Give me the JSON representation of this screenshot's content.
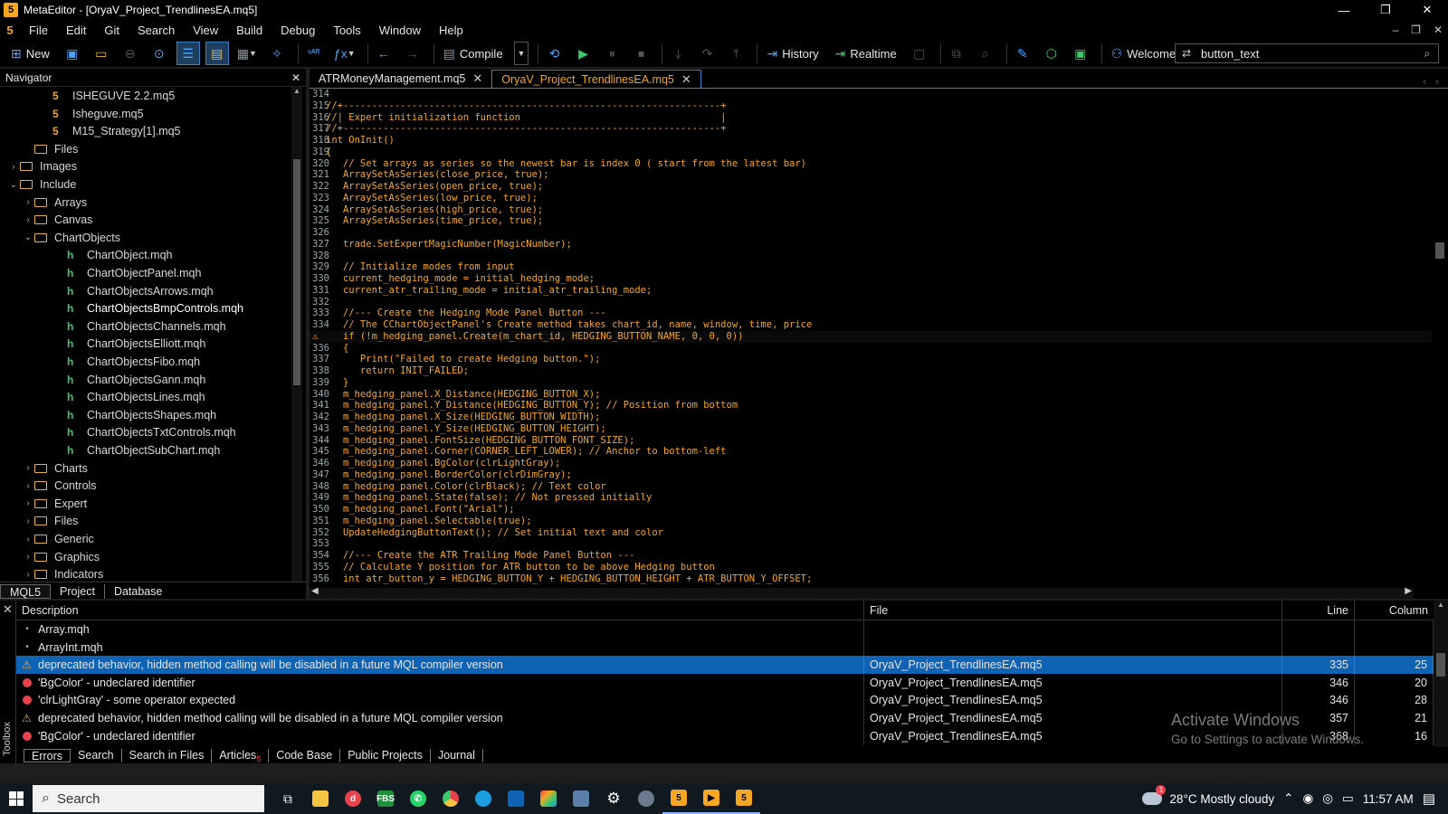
{
  "window": {
    "title": "MetaEditor - [OryaV_Project_TrendlinesEA.mq5]",
    "controls": [
      "—",
      "❐",
      "✕"
    ]
  },
  "menu": {
    "items": [
      "File",
      "Edit",
      "Git",
      "Search",
      "View",
      "Build",
      "Debug",
      "Tools",
      "Window",
      "Help"
    ]
  },
  "toolbar": {
    "new_label": "New",
    "compile_label": "Compile",
    "history_label": "History",
    "realtime_label": "Realtime",
    "welcome_label": "Welcome",
    "search_value": "button_text"
  },
  "navigator": {
    "title": "Navigator",
    "tabs": [
      "MQL5",
      "Project",
      "Database"
    ],
    "nodes": [
      {
        "label": "ISHEGUVE 2.2.mq5",
        "kind": "mq5",
        "arrow": ""
      },
      {
        "label": "Isheguve.mq5",
        "kind": "mq5",
        "arrow": ""
      },
      {
        "label": "M15_Strategy[1].mq5",
        "kind": "mq5",
        "arrow": ""
      },
      {
        "label": "Files",
        "kind": "folder",
        "arrow": ""
      },
      {
        "label": "Images",
        "kind": "folder",
        "arrow": "›"
      },
      {
        "label": "Include",
        "kind": "folder",
        "arrow": "⌄"
      },
      {
        "label": "Arrays",
        "kind": "folder",
        "arrow": "›"
      },
      {
        "label": "Canvas",
        "kind": "folder",
        "arrow": "›"
      },
      {
        "label": "ChartObjects",
        "kind": "folder",
        "arrow": "⌄"
      },
      {
        "label": "ChartObject.mqh",
        "kind": "mqh",
        "arrow": ""
      },
      {
        "label": "ChartObjectPanel.mqh",
        "kind": "mqh",
        "arrow": ""
      },
      {
        "label": "ChartObjectsArrows.mqh",
        "kind": "mqh",
        "arrow": ""
      },
      {
        "label": "ChartObjectsBmpControls.mqh",
        "kind": "mqh",
        "arrow": ""
      },
      {
        "label": "ChartObjectsChannels.mqh",
        "kind": "mqh",
        "arrow": ""
      },
      {
        "label": "ChartObjectsElliott.mqh",
        "kind": "mqh",
        "arrow": ""
      },
      {
        "label": "ChartObjectsFibo.mqh",
        "kind": "mqh",
        "arrow": ""
      },
      {
        "label": "ChartObjectsGann.mqh",
        "kind": "mqh",
        "arrow": ""
      },
      {
        "label": "ChartObjectsLines.mqh",
        "kind": "mqh",
        "arrow": ""
      },
      {
        "label": "ChartObjectsShapes.mqh",
        "kind": "mqh",
        "arrow": ""
      },
      {
        "label": "ChartObjectsTxtControls.mqh",
        "kind": "mqh",
        "arrow": ""
      },
      {
        "label": "ChartObjectSubChart.mqh",
        "kind": "mqh",
        "arrow": ""
      },
      {
        "label": "Charts",
        "kind": "folder",
        "arrow": "›"
      },
      {
        "label": "Controls",
        "kind": "folder",
        "arrow": "›"
      },
      {
        "label": "Expert",
        "kind": "folder",
        "arrow": "›"
      },
      {
        "label": "Files",
        "kind": "folder",
        "arrow": "›"
      },
      {
        "label": "Generic",
        "kind": "folder",
        "arrow": "›"
      },
      {
        "label": "Graphics",
        "kind": "folder",
        "arrow": "›"
      },
      {
        "label": "Indicators",
        "kind": "folder",
        "arrow": "›"
      }
    ]
  },
  "editor": {
    "tabs": [
      {
        "label": "ATRMoneyManagement.mq5",
        "active": false
      },
      {
        "label": "OryaV_Project_TrendlinesEA.mq5",
        "active": true
      }
    ],
    "lines": [
      {
        "n": "314",
        "t": ""
      },
      {
        "n": "315",
        "t": "//+------------------------------------------------------------------+"
      },
      {
        "n": "316",
        "t": "//| Expert initialization function                                   |"
      },
      {
        "n": "317",
        "t": "//+------------------------------------------------------------------+"
      },
      {
        "n": "318",
        "t": "int OnInit()"
      },
      {
        "n": "319",
        "t": "{"
      },
      {
        "n": "320",
        "t": "   // Set arrays as series so the newest bar is index 0 ( start from the latest bar)"
      },
      {
        "n": "321",
        "t": "   ArraySetAsSeries(close_price, true);"
      },
      {
        "n": "322",
        "t": "   ArraySetAsSeries(open_price, true);"
      },
      {
        "n": "323",
        "t": "   ArraySetAsSeries(low_price, true);"
      },
      {
        "n": "324",
        "t": "   ArraySetAsSeries(high_price, true);"
      },
      {
        "n": "325",
        "t": "   ArraySetAsSeries(time_price, true);"
      },
      {
        "n": "326",
        "t": ""
      },
      {
        "n": "327",
        "t": "   trade.SetExpertMagicNumber(MagicNumber);"
      },
      {
        "n": "328",
        "t": ""
      },
      {
        "n": "329",
        "t": "   // Initialize modes from input"
      },
      {
        "n": "330",
        "t": "   current_hedging_mode = initial_hedging_mode;"
      },
      {
        "n": "331",
        "t": "   current_atr_trailing_mode = initial_atr_trailing_mode;"
      },
      {
        "n": "332",
        "t": ""
      },
      {
        "n": "333",
        "t": "   //--- Create the Hedging Mode Panel Button ---"
      },
      {
        "n": "334",
        "t": "   // The CChartObjectPanel's Create method takes chart_id, name, window, time, price"
      },
      {
        "n": "",
        "t": "   if (!m_hedging_panel.Create(m_chart_id, HEDGING_BUTTON_NAME, 0, 0, 0))"
      },
      {
        "n": "336",
        "t": "   {"
      },
      {
        "n": "337",
        "t": "      Print(\"Failed to create Hedging button.\");"
      },
      {
        "n": "338",
        "t": "      return INIT_FAILED;"
      },
      {
        "n": "339",
        "t": "   }"
      },
      {
        "n": "340",
        "t": "   m_hedging_panel.X_Distance(HEDGING_BUTTON_X);"
      },
      {
        "n": "341",
        "t": "   m_hedging_panel.Y_Distance(HEDGING_BUTTON_Y); // Position from bottom"
      },
      {
        "n": "342",
        "t": "   m_hedging_panel.X_Size(HEDGING_BUTTON_WIDTH);"
      },
      {
        "n": "343",
        "t": "   m_hedging_panel.Y_Size(HEDGING_BUTTON_HEIGHT);"
      },
      {
        "n": "344",
        "t": "   m_hedging_panel.FontSize(HEDGING_BUTTON_FONT_SIZE);"
      },
      {
        "n": "345",
        "t": "   m_hedging_panel.Corner(CORNER_LEFT_LOWER); // Anchor to bottom-left"
      },
      {
        "n": "346",
        "t": "   m_hedging_panel.BgColor(clrLightGray);"
      },
      {
        "n": "347",
        "t": "   m_hedging_panel.BorderColor(clrDimGray);"
      },
      {
        "n": "348",
        "t": "   m_hedging_panel.Color(clrBlack); // Text color"
      },
      {
        "n": "349",
        "t": "   m_hedging_panel.State(false); // Not pressed initially"
      },
      {
        "n": "350",
        "t": "   m_hedging_panel.Font(\"Arial\");"
      },
      {
        "n": "351",
        "t": "   m_hedging_panel.Selectable(true);"
      },
      {
        "n": "352",
        "t": "   UpdateHedgingButtonText(); // Set initial text and color"
      },
      {
        "n": "353",
        "t": ""
      },
      {
        "n": "354",
        "t": "   //--- Create the ATR Trailing Mode Panel Button ---"
      },
      {
        "n": "355",
        "t": "   // Calculate Y position for ATR button to be above Hedging button"
      },
      {
        "n": "356",
        "t": "   int atr_button_y = HEDGING_BUTTON_Y + HEDGING_BUTTON_HEIGHT + ATR_BUTTON_Y_OFFSET;"
      }
    ]
  },
  "toolbox": {
    "label": "Toolbox",
    "columns": [
      "Description",
      "File",
      "Line",
      "Column"
    ],
    "rows": [
      {
        "icon": "dot",
        "desc": "Array.mqh",
        "file": "",
        "line": "",
        "col": ""
      },
      {
        "icon": "dot",
        "desc": "ArrayInt.mqh",
        "file": "",
        "line": "",
        "col": ""
      },
      {
        "icon": "warn",
        "desc": "deprecated behavior, hidden method calling will be disabled in a future MQL compiler version",
        "file": "OryaV_Project_TrendlinesEA.mq5",
        "line": "335",
        "col": "25"
      },
      {
        "icon": "err",
        "desc": "'BgColor' - undeclared identifier",
        "file": "OryaV_Project_TrendlinesEA.mq5",
        "line": "346",
        "col": "20"
      },
      {
        "icon": "err",
        "desc": "'clrLightGray' - some operator expected",
        "file": "OryaV_Project_TrendlinesEA.mq5",
        "line": "346",
        "col": "28"
      },
      {
        "icon": "warn",
        "desc": "deprecated behavior, hidden method calling will be disabled in a future MQL compiler version",
        "file": "OryaV_Project_TrendlinesEA.mq5",
        "line": "357",
        "col": "21"
      },
      {
        "icon": "err",
        "desc": "'BgColor' - undeclared identifier",
        "file": "OryaV_Project_TrendlinesEA.mq5",
        "line": "368",
        "col": "16"
      }
    ],
    "tabs": [
      {
        "label": "Errors",
        "count": ""
      },
      {
        "label": "Search",
        "count": ""
      },
      {
        "label": "Search in Files",
        "count": ""
      },
      {
        "label": "Articles",
        "count": "5"
      },
      {
        "label": "Code Base",
        "count": ""
      },
      {
        "label": "Public Projects",
        "count": ""
      },
      {
        "label": "Journal",
        "count": ""
      }
    ]
  },
  "watermark": {
    "line1": "Activate Windows",
    "line2": "Go to Settings to activate Windows."
  },
  "taskbar": {
    "search_placeholder": "Search",
    "weather": "28°C  Mostly cloudy",
    "time": "11:57 AM"
  },
  "colors": {
    "accent": "#0e63b5",
    "mql_orange": "#f5a623",
    "comment_green": "#3cc86b",
    "error_red": "#e8424c"
  }
}
